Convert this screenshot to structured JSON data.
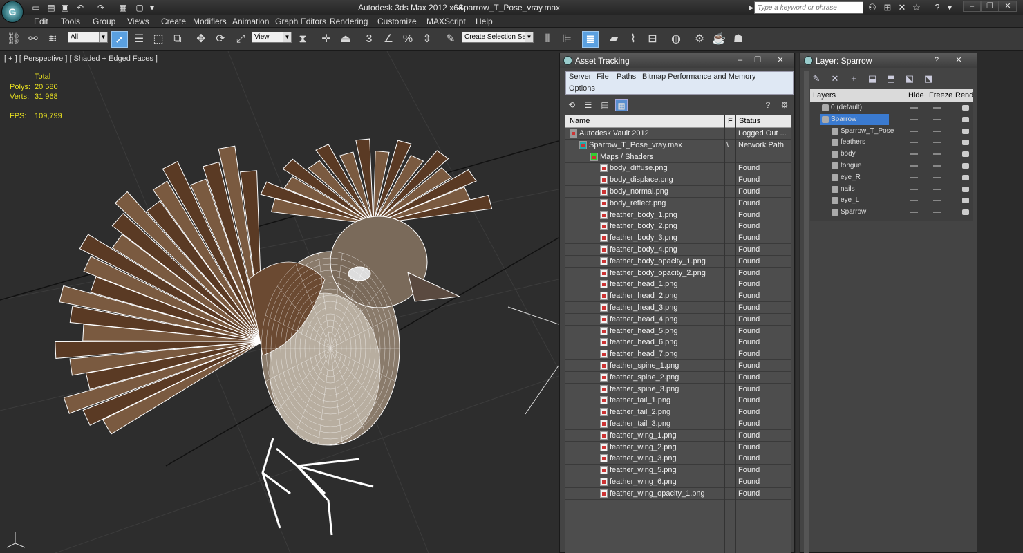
{
  "window": {
    "app_title": "Autodesk 3ds Max  2012 x64",
    "file_name": "Sparrow_T_Pose_vray.max",
    "logo_text": "G",
    "search_placeholder": "Type a keyword or phrase"
  },
  "menu": [
    "Edit",
    "Tools",
    "Group",
    "Views",
    "Create",
    "Modifiers",
    "Animation",
    "Graph Editors",
    "Rendering",
    "Customize",
    "MAXScript",
    "Help"
  ],
  "toolbar": {
    "filter_value": "All",
    "ref_coord_value": "View",
    "selection_set_value": "Create Selection Se"
  },
  "viewport": {
    "label": "[ + ] [ Perspective ] [ Shaded + Edged Faces ]",
    "stats_header": "Total",
    "polys_label": "Polys:",
    "polys_value": "20 580",
    "verts_label": "Verts:",
    "verts_value": "31 968",
    "fps_label": "FPS:",
    "fps_value": "109,799"
  },
  "asset_tracking": {
    "title": "Asset Tracking",
    "menu": [
      "Server",
      "File",
      "Paths",
      "Bitmap Performance and Memory",
      "Options"
    ],
    "columns": {
      "name": "Name",
      "flag": "F",
      "status": "Status"
    },
    "rows": [
      {
        "name": "Autodesk Vault 2012",
        "flag": "",
        "status": "Logged Out ...",
        "level": 1,
        "kind": "vault"
      },
      {
        "name": "Sparrow_T_Pose_vray.max",
        "flag": "\\",
        "status": "Network Path",
        "level": 2,
        "kind": "max"
      },
      {
        "name": "Maps / Shaders",
        "flag": "",
        "status": "",
        "level": 3,
        "kind": "folder"
      },
      {
        "name": "body_diffuse.png",
        "flag": "",
        "status": "Found",
        "level": 4,
        "kind": "file"
      },
      {
        "name": "body_displace.png",
        "flag": "",
        "status": "Found",
        "level": 4,
        "kind": "file"
      },
      {
        "name": "body_normal.png",
        "flag": "",
        "status": "Found",
        "level": 4,
        "kind": "file"
      },
      {
        "name": "body_reflect.png",
        "flag": "",
        "status": "Found",
        "level": 4,
        "kind": "file"
      },
      {
        "name": "feather_body_1.png",
        "flag": "",
        "status": "Found",
        "level": 4,
        "kind": "file"
      },
      {
        "name": "feather_body_2.png",
        "flag": "",
        "status": "Found",
        "level": 4,
        "kind": "file"
      },
      {
        "name": "feather_body_3.png",
        "flag": "",
        "status": "Found",
        "level": 4,
        "kind": "file"
      },
      {
        "name": "feather_body_4.png",
        "flag": "",
        "status": "Found",
        "level": 4,
        "kind": "file"
      },
      {
        "name": "feather_body_opacity_1.png",
        "flag": "",
        "status": "Found",
        "level": 4,
        "kind": "file"
      },
      {
        "name": "feather_body_opacity_2.png",
        "flag": "",
        "status": "Found",
        "level": 4,
        "kind": "file"
      },
      {
        "name": "feather_head_1.png",
        "flag": "",
        "status": "Found",
        "level": 4,
        "kind": "file"
      },
      {
        "name": "feather_head_2.png",
        "flag": "",
        "status": "Found",
        "level": 4,
        "kind": "file"
      },
      {
        "name": "feather_head_3.png",
        "flag": "",
        "status": "Found",
        "level": 4,
        "kind": "file"
      },
      {
        "name": "feather_head_4.png",
        "flag": "",
        "status": "Found",
        "level": 4,
        "kind": "file"
      },
      {
        "name": "feather_head_5.png",
        "flag": "",
        "status": "Found",
        "level": 4,
        "kind": "file"
      },
      {
        "name": "feather_head_6.png",
        "flag": "",
        "status": "Found",
        "level": 4,
        "kind": "file"
      },
      {
        "name": "feather_head_7.png",
        "flag": "",
        "status": "Found",
        "level": 4,
        "kind": "file"
      },
      {
        "name": "feather_spine_1.png",
        "flag": "",
        "status": "Found",
        "level": 4,
        "kind": "file"
      },
      {
        "name": "feather_spine_2.png",
        "flag": "",
        "status": "Found",
        "level": 4,
        "kind": "file"
      },
      {
        "name": "feather_spine_3.png",
        "flag": "",
        "status": "Found",
        "level": 4,
        "kind": "file"
      },
      {
        "name": "feather_tail_1.png",
        "flag": "",
        "status": "Found",
        "level": 4,
        "kind": "file"
      },
      {
        "name": "feather_tail_2.png",
        "flag": "",
        "status": "Found",
        "level": 4,
        "kind": "file"
      },
      {
        "name": "feather_tail_3.png",
        "flag": "",
        "status": "Found",
        "level": 4,
        "kind": "file"
      },
      {
        "name": "feather_wing_1.png",
        "flag": "",
        "status": "Found",
        "level": 4,
        "kind": "file"
      },
      {
        "name": "feather_wing_2.png",
        "flag": "",
        "status": "Found",
        "level": 4,
        "kind": "file"
      },
      {
        "name": "feather_wing_3.png",
        "flag": "",
        "status": "Found",
        "level": 4,
        "kind": "file"
      },
      {
        "name": "feather_wing_5.png",
        "flag": "",
        "status": "Found",
        "level": 4,
        "kind": "file"
      },
      {
        "name": "feather_wing_6.png",
        "flag": "",
        "status": "Found",
        "level": 4,
        "kind": "file"
      },
      {
        "name": "feather_wing_opacity_1.png",
        "flag": "",
        "status": "Found",
        "level": 4,
        "kind": "file"
      }
    ]
  },
  "layer_panel": {
    "title": "Layer: Sparrow",
    "columns": {
      "layers": "Layers",
      "hide": "Hide",
      "freeze": "Freeze",
      "render": "Rende"
    },
    "rows": [
      {
        "name": "0 (default)",
        "level": 1,
        "selected": false
      },
      {
        "name": "Sparrow",
        "level": 1,
        "selected": true
      },
      {
        "name": "Sparrow_T_Pose",
        "level": 2,
        "selected": false
      },
      {
        "name": "feathers",
        "level": 2,
        "selected": false
      },
      {
        "name": "body",
        "level": 2,
        "selected": false
      },
      {
        "name": "tongue",
        "level": 2,
        "selected": false
      },
      {
        "name": "eye_R",
        "level": 2,
        "selected": false
      },
      {
        "name": "nails",
        "level": 2,
        "selected": false
      },
      {
        "name": "eye_L",
        "level": 2,
        "selected": false
      },
      {
        "name": "Sparrow",
        "level": 2,
        "selected": false
      }
    ]
  },
  "colors": {
    "accent": "#3a7ad0",
    "stats_yellow": "#e8e020",
    "panel_bg": "#444444"
  }
}
